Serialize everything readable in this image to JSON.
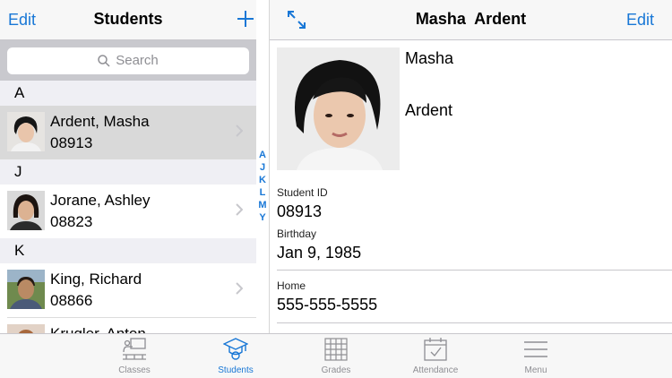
{
  "master": {
    "edit_label": "Edit",
    "title": "Students",
    "search_placeholder": "Search",
    "sections": [
      {
        "letter": "A",
        "students": [
          {
            "name": "Ardent, Masha",
            "id": "08913",
            "selected": true
          }
        ]
      },
      {
        "letter": "J",
        "students": [
          {
            "name": "Jorane, Ashley",
            "id": "08823"
          }
        ]
      },
      {
        "letter": "K",
        "students": [
          {
            "name": "King, Richard",
            "id": "08866"
          },
          {
            "name": "Krugler, Anton"
          }
        ]
      }
    ],
    "index_letters": [
      "A",
      "J",
      "K",
      "L",
      "M",
      "Y"
    ]
  },
  "detail": {
    "title": "Masha  Ardent",
    "edit_label": "Edit",
    "first_name": "Masha",
    "last_name": "Ardent",
    "student_id_label": "Student ID",
    "student_id": "08913",
    "birthday_label": "Birthday",
    "birthday": "Jan 9, 1985",
    "home_label": "Home",
    "home_phone": "555-555-5555"
  },
  "tabs": [
    {
      "label": "Classes",
      "icon": "classroom-icon"
    },
    {
      "label": "Students",
      "icon": "graduation-cap-icon",
      "active": true
    },
    {
      "label": "Grades",
      "icon": "grid-icon"
    },
    {
      "label": "Attendance",
      "icon": "calendar-check-icon"
    },
    {
      "label": "Menu",
      "icon": "hamburger-menu-icon"
    }
  ],
  "colors": {
    "accent": "#1877d6",
    "section_bg": "#efeff4",
    "selected_row": "#d9d9d9",
    "bar_bg": "#f7f7f7"
  }
}
